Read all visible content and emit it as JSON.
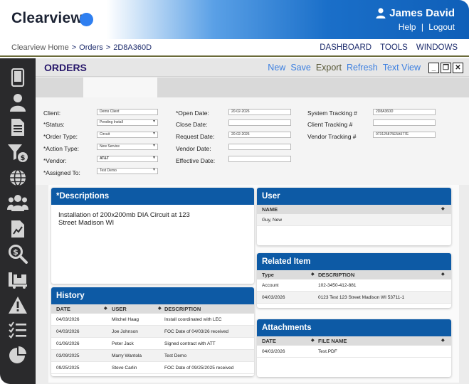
{
  "app": {
    "logo": "Clearview"
  },
  "user": {
    "name": "James David",
    "help": "Help",
    "sep": "|",
    "logout": "Logout"
  },
  "breadcrumb": [
    "Clearview Home",
    "Orders",
    "2D8A360D"
  ],
  "breadcrumb_sep": ">",
  "topnav": [
    "DASHBOARD",
    "TOOLS",
    "WINDOWS"
  ],
  "sidebar_icons": [
    "phone-icon",
    "user-icon",
    "document-icon",
    "filter-dollar-icon",
    "globe-icon",
    "users-group-icon",
    "chart-document-icon",
    "search-dollar-icon",
    "truck-icon",
    "warning-icon",
    "checklist-icon",
    "pie-chart-icon"
  ],
  "orders": {
    "title": "ORDERS",
    "actions": {
      "new": "New",
      "save": "Save",
      "export": "Export",
      "refresh": "Refresh",
      "text_view": "Text View"
    }
  },
  "form": {
    "col1": [
      {
        "label": "Client:",
        "value": "Demo Client",
        "select": false
      },
      {
        "label": "*Status:",
        "value": "Pending Install",
        "select": true
      },
      {
        "label": "*Order Type:",
        "value": "Circuit",
        "select": true
      },
      {
        "label": "*Action Type:",
        "value": "New Service",
        "select": true
      },
      {
        "label": "*Vendor:",
        "value": "AT&T",
        "select": true
      },
      {
        "label": "*Assigned To:",
        "value": "Test Demo",
        "select": true
      }
    ],
    "col2": [
      {
        "label": "*Open Date:",
        "value": "20-02-2026"
      },
      {
        "label": "Close Date:",
        "value": ""
      },
      {
        "label": "Request Date:",
        "value": "20-02-2026"
      },
      {
        "label": "Vendor Date:",
        "value": ""
      },
      {
        "label": "Effective Date:",
        "value": ""
      }
    ],
    "col3": [
      {
        "label": "System Tracking #",
        "value": "2D8A360D"
      },
      {
        "label": "Client Tracking #",
        "value": ""
      },
      {
        "label": "Vendor Tracking #",
        "value": "073125875E5A577E"
      }
    ]
  },
  "descriptions": {
    "title": "*Descriptions",
    "text": "Installation of 200x200mb DIA Circuit at 123 Street Madison WI"
  },
  "history": {
    "title": "History",
    "headers": [
      "DATE",
      "USER",
      "DESCRIPTION"
    ],
    "rows": [
      [
        "04/03/2026",
        "Mitchel Haag",
        "Install coordinated with LEC"
      ],
      [
        "04/03/2026",
        "Joe Johnson",
        "FOC Date of 04/03/26 received"
      ],
      [
        "01/06/2026",
        "Peter Jack",
        "Signed contract with ATT"
      ],
      [
        "03/09/2025",
        "Marry Wantola",
        "Test Demo"
      ],
      [
        "09/25/2025",
        "Steve Carlin",
        "FOC Date of 09/25/2025 received"
      ]
    ]
  },
  "user_panel": {
    "title": "User",
    "headers": [
      "NAME"
    ],
    "rows": [
      [
        "Guy, New"
      ]
    ]
  },
  "related": {
    "title": "Related Item",
    "headers": [
      "Type",
      "DESCRIPTION"
    ],
    "rows": [
      [
        "Account",
        "102-3450-412-881"
      ],
      [
        "04/03/2026",
        "0123 Test 123 Street Madison WI 53711-1"
      ]
    ]
  },
  "attachments": {
    "title": "Attachments",
    "headers": [
      "DATE",
      "FILE NAME"
    ],
    "rows": [
      [
        "04/03/2026",
        "Test.PDF"
      ]
    ]
  },
  "colors": {
    "header_blue": "#0d5aa5",
    "sidebar": "#2a2a2c",
    "orders_title": "#26166a",
    "action_blue": "#3c7fe0"
  }
}
